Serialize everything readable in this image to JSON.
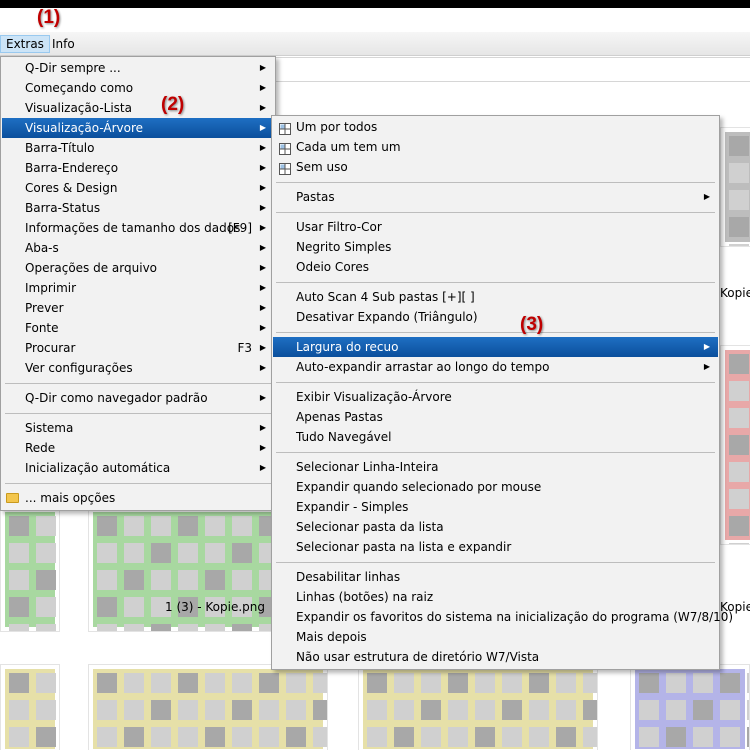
{
  "callouts": [
    "(1)",
    "(2)",
    "(3)"
  ],
  "menubar": {
    "extras": "Extras",
    "info": "Info"
  },
  "extras_menu": [
    {
      "label": "Q-Dir sempre ...",
      "arrow": true
    },
    {
      "label": "Começando como",
      "arrow": true
    },
    {
      "label": "Visualização-Lista",
      "arrow": true
    },
    {
      "label": "Visualização-Árvore",
      "arrow": true,
      "selected": true
    },
    {
      "label": "Barra-Título",
      "arrow": true
    },
    {
      "label": "Barra-Endereço",
      "arrow": true
    },
    {
      "label": "Cores & Design",
      "arrow": true
    },
    {
      "label": "Barra-Status",
      "arrow": true
    },
    {
      "label": "Informações de tamanho dos dados",
      "shortcut": "[F9]",
      "arrow": true
    },
    {
      "label": "Aba-s",
      "arrow": true
    },
    {
      "label": "Operações de arquivo",
      "arrow": true
    },
    {
      "label": "Imprimir",
      "arrow": true
    },
    {
      "label": "Prever",
      "arrow": true
    },
    {
      "label": "Fonte",
      "arrow": true
    },
    {
      "label": "Procurar",
      "shortcut": "F3",
      "arrow": true
    },
    {
      "label": "Ver configurações",
      "arrow": true
    },
    {
      "sep": true
    },
    {
      "label": "Q-Dir como navegador padrão",
      "arrow": true
    },
    {
      "sep": true
    },
    {
      "label": "Sistema",
      "arrow": true
    },
    {
      "label": "Rede",
      "arrow": true
    },
    {
      "label": "Inicialização automática",
      "arrow": true
    },
    {
      "sep": true
    },
    {
      "label": "... mais opções",
      "icon": "folder-icon"
    }
  ],
  "tree_menu": [
    {
      "label": "Um por todos",
      "icon": "grid-icon"
    },
    {
      "label": "Cada um tem um",
      "icon": "grid-icon"
    },
    {
      "label": "Sem uso",
      "icon": "grid-icon"
    },
    {
      "sep": true
    },
    {
      "label": "Pastas",
      "arrow": true
    },
    {
      "sep": true
    },
    {
      "label": "Usar Filtro-Cor"
    },
    {
      "label": "Negrito Simples"
    },
    {
      "label": "Odeio Cores"
    },
    {
      "sep": true
    },
    {
      "label": "Auto Scan 4 Sub pastas [+][ ]"
    },
    {
      "label": "Desativar Expando (Triângulo)"
    },
    {
      "sep": true
    },
    {
      "label": "Largura do recuo",
      "arrow": true,
      "selected": true
    },
    {
      "label": "Auto-expandir arrastar ao longo do tempo",
      "arrow": true
    },
    {
      "sep": true
    },
    {
      "label": "Exibir Visualização-Árvore"
    },
    {
      "label": "Apenas Pastas"
    },
    {
      "label": "Tudo Navegável"
    },
    {
      "sep": true
    },
    {
      "label": "Selecionar Linha-Inteira"
    },
    {
      "label": "Expandir quando selecionado por mouse"
    },
    {
      "label": "Expandir - Simples"
    },
    {
      "label": "Selecionar pasta da lista"
    },
    {
      "label": "Selecionar pasta na lista e expandir"
    },
    {
      "sep": true
    },
    {
      "label": "Desabilitar linhas"
    },
    {
      "label": "Linhas (botões) na raiz"
    },
    {
      "label": "Expandir os favoritos do sistema na inicialização do programa (W7/8/10)"
    },
    {
      "label": "Mais depois"
    },
    {
      "label": "Não usar estrutura de diretório W7/Vista"
    }
  ],
  "background": {
    "captions": [
      "Kopie",
      "1 (3) - Kopie.png",
      "Kopie"
    ],
    "colors": {
      "gray": "#bdbdbd",
      "green": "#a8d8a0",
      "red": "#e8a8a8",
      "yellow": "#e6e0a8",
      "blue": "#b4b4e8"
    }
  },
  "accent": {
    "selection": "#0b4f9c",
    "callout": "#c00000"
  }
}
